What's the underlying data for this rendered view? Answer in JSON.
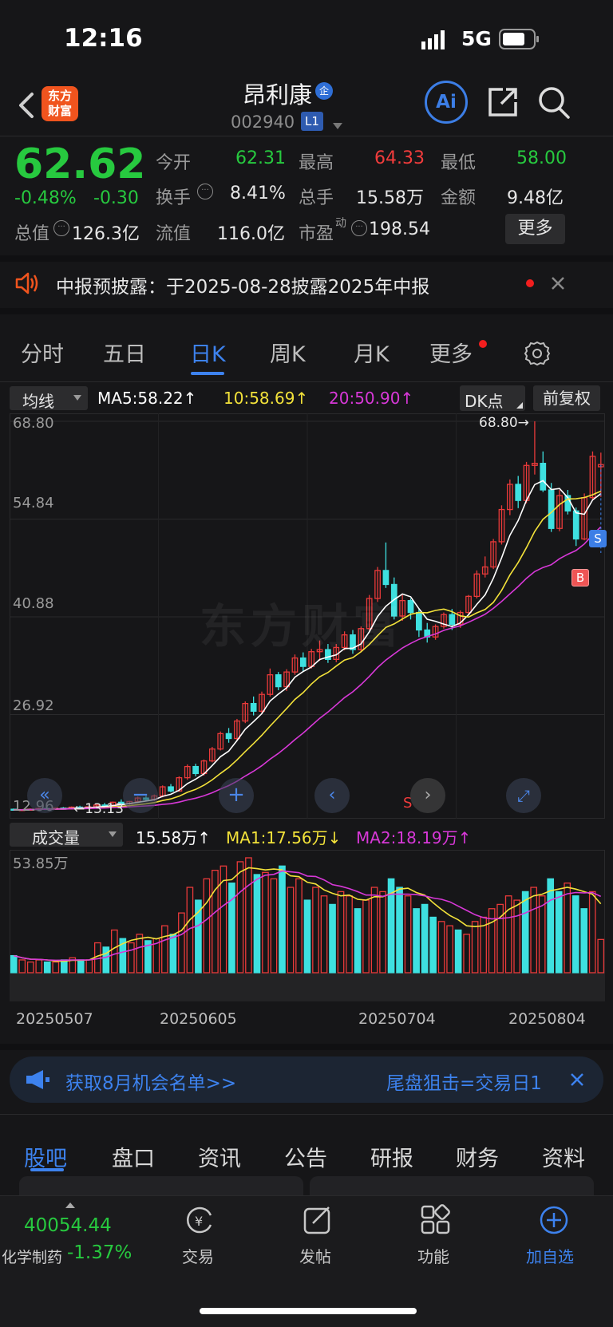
{
  "status": {
    "time": "12:16",
    "network": "5G"
  },
  "header": {
    "title": "昂利康",
    "badge": "企",
    "code": "002940",
    "level": "L1",
    "logo_line1": "东方",
    "logo_line2": "财富",
    "ai_label": "Ai"
  },
  "quote": {
    "price": "62.62",
    "pct": "-0.48%",
    "chg": "-0.30",
    "open_label": "今开",
    "open": "62.31",
    "high_label": "最高",
    "high": "64.33",
    "low_label": "最低",
    "low": "58.00",
    "turnover_label": "换手",
    "turnover": "8.41%",
    "vol_label": "总手",
    "vol": "15.58万",
    "amount_label": "金额",
    "amount": "9.48亿",
    "mcap_label": "总值",
    "mcap": "126.3亿",
    "float_label": "流值",
    "float": "116.0亿",
    "pe_label": "市盈",
    "pe_sup": "动",
    "pe": "198.54",
    "more": "更多"
  },
  "notice": {
    "text": "中报预披露：于2025-08-28披露2025年中报"
  },
  "tabs": [
    "分时",
    "五日",
    "日K",
    "周K",
    "月K",
    "更多"
  ],
  "ma_bar": {
    "select": "均线",
    "ma5": "MA5:58.22↑",
    "ma10": "10:58.69↑",
    "ma20": "20:50.90↑",
    "dk": "DK点",
    "fq": "前复权"
  },
  "price_axis": [
    "68.80",
    "54.84",
    "40.88",
    "26.92",
    "12.96"
  ],
  "max_label": "68.80→",
  "min_label": "←13.13",
  "markers": {
    "b": "B",
    "s": "S",
    "s2": "S"
  },
  "watermark": "东方财富",
  "vol_bar": {
    "select": "成交量",
    "val": "15.58万↑",
    "ma1": "MA1:17.56万↓",
    "ma2": "MA2:18.19万↑",
    "max": "53.85万"
  },
  "dates": [
    "20250507",
    "20250605",
    "20250704",
    "20250804"
  ],
  "banner": {
    "left": "获取8月机会名单>>",
    "right": "尾盘狙击=交易日1"
  },
  "tabs2": [
    "股吧",
    "盘口",
    "资讯",
    "公告",
    "研报",
    "财务",
    "资料"
  ],
  "bottom": {
    "index": "40054.44",
    "sector": "化学制药",
    "sector_pct": "-1.37%",
    "trade": "交易",
    "post": "发帖",
    "func": "功能",
    "add": "加自选"
  },
  "chart_data": {
    "type": "candlestick",
    "x": [
      "2025-05-07",
      "2025-06-05",
      "2025-07-04",
      "2025-08-04"
    ],
    "ylim": [
      12.96,
      68.8
    ],
    "ohlc": [
      [
        13.4,
        13.5,
        13.2,
        13.3
      ],
      [
        13.3,
        13.4,
        13.13,
        13.35
      ],
      [
        13.35,
        13.5,
        13.2,
        13.4
      ],
      [
        13.4,
        13.6,
        13.3,
        13.5
      ],
      [
        13.5,
        13.6,
        13.3,
        13.4
      ],
      [
        13.4,
        13.6,
        13.3,
        13.55
      ],
      [
        13.55,
        13.7,
        13.4,
        13.5
      ],
      [
        13.5,
        13.8,
        13.4,
        13.7
      ],
      [
        13.7,
        13.9,
        13.5,
        13.6
      ],
      [
        13.6,
        13.8,
        13.5,
        13.75
      ],
      [
        13.75,
        14.2,
        13.6,
        14.0
      ],
      [
        14.0,
        14.3,
        13.8,
        13.9
      ],
      [
        13.9,
        14.5,
        13.8,
        14.4
      ],
      [
        14.4,
        14.8,
        14.1,
        14.2
      ],
      [
        14.2,
        14.6,
        14.0,
        14.5
      ],
      [
        14.5,
        15.2,
        14.3,
        15.0
      ],
      [
        15.0,
        15.3,
        14.6,
        14.8
      ],
      [
        14.8,
        15.5,
        14.6,
        15.3
      ],
      [
        15.3,
        16.8,
        15.1,
        16.6
      ],
      [
        16.6,
        17.0,
        15.8,
        16.0
      ],
      [
        16.0,
        18.1,
        15.9,
        17.9
      ],
      [
        17.9,
        19.8,
        17.6,
        19.5
      ],
      [
        19.5,
        19.9,
        18.1,
        18.5
      ],
      [
        18.5,
        20.5,
        18.2,
        20.3
      ],
      [
        20.3,
        22.3,
        20.1,
        22.0
      ],
      [
        22.0,
        24.5,
        21.8,
        24.2
      ],
      [
        24.2,
        25.0,
        22.9,
        23.5
      ],
      [
        23.5,
        26.3,
        23.2,
        26.0
      ],
      [
        26.0,
        28.8,
        25.7,
        28.5
      ],
      [
        28.5,
        29.5,
        26.8,
        27.4
      ],
      [
        27.4,
        30.2,
        27.0,
        29.8
      ],
      [
        29.8,
        33.5,
        29.5,
        32.6
      ],
      [
        32.6,
        33.0,
        30.4,
        30.9
      ],
      [
        30.9,
        33.4,
        30.3,
        33.0
      ],
      [
        33.0,
        35.5,
        32.6,
        35.0
      ],
      [
        35.0,
        35.8,
        33.0,
        33.8
      ],
      [
        33.8,
        36.3,
        33.5,
        35.9
      ],
      [
        35.9,
        37.5,
        34.6,
        36.2
      ],
      [
        36.2,
        37.0,
        34.3,
        34.8
      ],
      [
        34.8,
        37.0,
        34.4,
        36.5
      ],
      [
        36.5,
        38.8,
        36.1,
        38.3
      ],
      [
        38.3,
        39.0,
        35.6,
        36.2
      ],
      [
        36.2,
        39.5,
        35.8,
        39.2
      ],
      [
        39.2,
        44.0,
        38.9,
        43.5
      ],
      [
        43.5,
        48.0,
        43.0,
        47.5
      ],
      [
        47.5,
        51.5,
        45.0,
        45.5
      ],
      [
        45.5,
        46.5,
        40.5,
        41.0
      ],
      [
        41.0,
        44.0,
        40.3,
        43.2
      ],
      [
        43.2,
        43.5,
        40.5,
        41.5
      ],
      [
        41.5,
        42.0,
        38.0,
        39.0
      ],
      [
        39.0,
        40.0,
        37.2,
        38.0
      ],
      [
        38.0,
        39.8,
        37.6,
        39.5
      ],
      [
        39.5,
        41.5,
        39.2,
        41.2
      ],
      [
        41.2,
        42.0,
        39.0,
        39.8
      ],
      [
        39.8,
        41.8,
        39.3,
        41.5
      ],
      [
        41.5,
        44.0,
        41.2,
        43.8
      ],
      [
        43.8,
        47.5,
        43.5,
        47.0
      ],
      [
        47.0,
        49.5,
        46.5,
        48.0
      ],
      [
        48.0,
        52.0,
        47.7,
        51.6
      ],
      [
        51.6,
        56.8,
        51.2,
        56.2
      ],
      [
        56.2,
        60.5,
        55.4,
        59.8
      ],
      [
        59.8,
        61.0,
        56.4,
        57.5
      ],
      [
        57.5,
        63.0,
        57.1,
        62.5
      ],
      [
        62.5,
        68.8,
        61.2,
        62.8
      ],
      [
        62.8,
        64.5,
        58.7,
        59.0
      ],
      [
        59.0,
        60.0,
        53.0,
        53.5
      ],
      [
        53.5,
        59.0,
        53.1,
        58.2
      ],
      [
        58.2,
        59.0,
        55.5,
        56.0
      ],
      [
        56.0,
        56.5,
        51.0,
        52.0
      ],
      [
        52.0,
        58.5,
        51.8,
        57.9
      ],
      [
        57.9,
        64.5,
        57.5,
        63.8
      ],
      [
        62.31,
        64.33,
        58.0,
        62.62
      ]
    ],
    "ma5_last": 58.22,
    "ma10_last": 58.69,
    "ma20_last": 50.9,
    "volume_wan": [
      8,
      6,
      5,
      6,
      5,
      5,
      6,
      7,
      6,
      6,
      14,
      12,
      20,
      16,
      14,
      18,
      15,
      16,
      22,
      18,
      28,
      40,
      34,
      44,
      48,
      50,
      42,
      52,
      53.85,
      46,
      47,
      44,
      50,
      40,
      44,
      34,
      40,
      36,
      32,
      38,
      36,
      30,
      34,
      40,
      38,
      44,
      40,
      36,
      30,
      32,
      26,
      24,
      22,
      20,
      18,
      24,
      26,
      30,
      32,
      36,
      34,
      38,
      40,
      36,
      44,
      38,
      42,
      36,
      30,
      38,
      15.58
    ],
    "ma1_last": 17.56,
    "ma2_last": 18.19
  }
}
